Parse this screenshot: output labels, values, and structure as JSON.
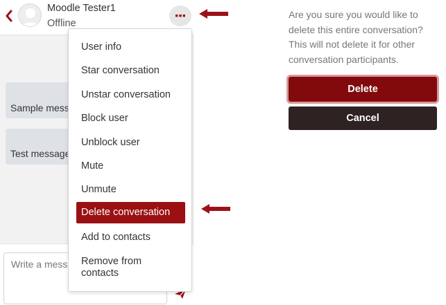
{
  "header": {
    "user_name": "Moodle Tester1",
    "user_status": "Offline",
    "menu_icon": "ellipsis-icon",
    "back_icon": "chevron-left-icon"
  },
  "messages": [
    {
      "text": "Sample message"
    },
    {
      "text": "Test message"
    }
  ],
  "compose": {
    "placeholder": "Write a message..."
  },
  "dropdown": {
    "items": [
      {
        "label": "User info"
      },
      {
        "label": "Star conversation"
      },
      {
        "label": "Unstar conversation"
      },
      {
        "label": "Block user"
      },
      {
        "label": "Unblock user"
      },
      {
        "label": "Mute"
      },
      {
        "label": "Unmute"
      },
      {
        "label": "Delete conversation",
        "active": true
      },
      {
        "label": "Add to contacts"
      },
      {
        "label": "Remove from contacts"
      }
    ]
  },
  "confirm": {
    "text": "Are you sure you would like to delete this entire conversation? This will not delete it for other conversation participants.",
    "delete_label": "Delete",
    "cancel_label": "Cancel"
  },
  "colors": {
    "brand": "#9a1013",
    "delete_button": "#820a0d",
    "cancel_button": "#2e2222",
    "arrow": "#9a1318"
  }
}
